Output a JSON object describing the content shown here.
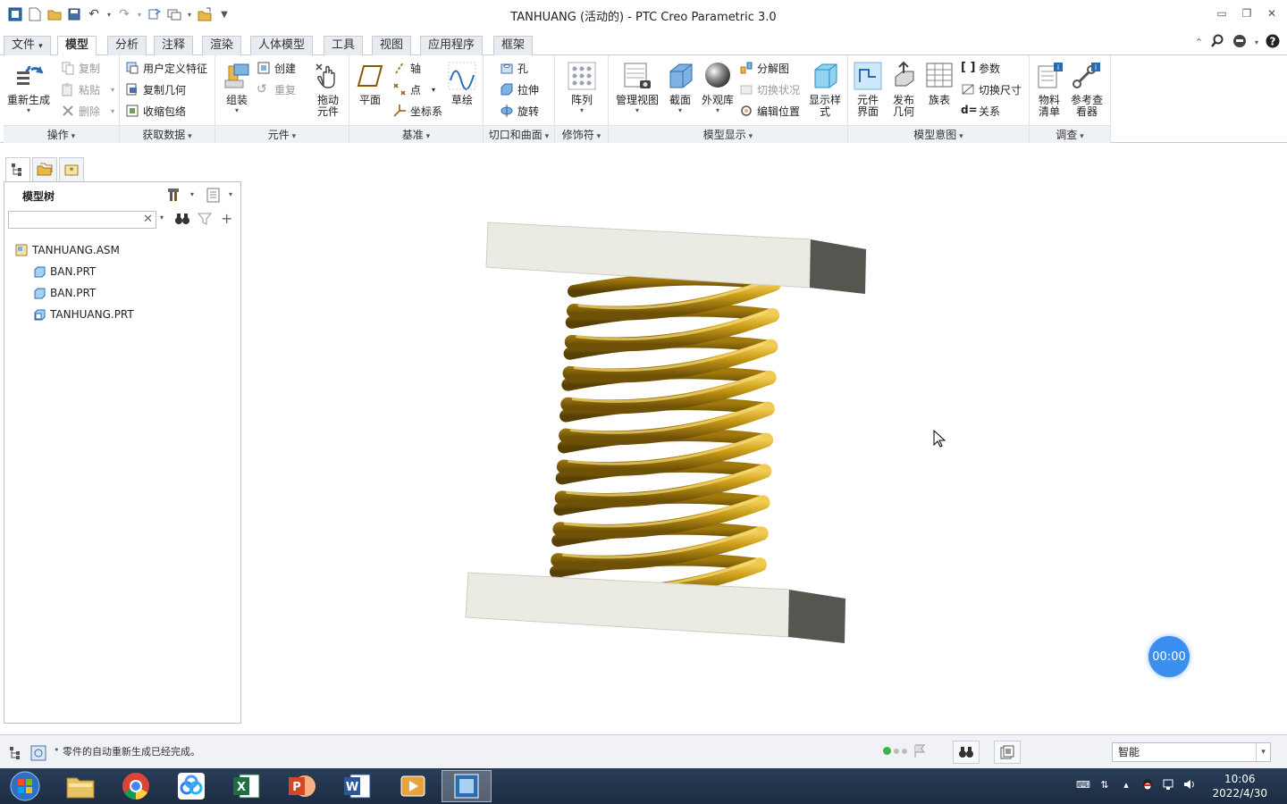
{
  "window": {
    "title": "TANHUANG (活动的) - PTC Creo Parametric 3.0"
  },
  "ribbon": {
    "tabs": [
      "文件",
      "模型",
      "分析",
      "注释",
      "渲染",
      "人体模型",
      "工具",
      "视图",
      "应用程序",
      "框架"
    ],
    "active_tab": "模型",
    "groups": {
      "operations": {
        "label": "操作",
        "regenerate": "重新生成",
        "copy": "复制",
        "paste": "粘贴",
        "delete": "删除"
      },
      "get_data": {
        "label": "获取数据",
        "udf": "用户定义特征",
        "copy_geom": "复制几何",
        "shrinkwrap": "收缩包络"
      },
      "component": {
        "label": "元件",
        "assemble": "组装",
        "create": "创建",
        "repeat": "重复",
        "drag": "拖动元件"
      },
      "datum": {
        "label": "基准",
        "plane": "平面",
        "axis": "轴",
        "point": "点",
        "csys": "坐标系",
        "sketch": "草绘"
      },
      "cut_surface": {
        "label": "切口和曲面",
        "hole": "孔",
        "extrude": "拉伸",
        "revolve": "旋转"
      },
      "modifiers": {
        "label": "修饰符",
        "pattern": "阵列"
      },
      "model_display": {
        "label": "模型显示",
        "manage_views": "管理视图",
        "section": "截面",
        "appearance": "外观库",
        "explode": "分解图",
        "toggle_status": "切换状况",
        "edit_position": "编辑位置",
        "display_style": "显示样式"
      },
      "model_intent": {
        "label": "模型意图",
        "comp_interface": "元件界面",
        "publish_geom": "发布几何",
        "family_table": "族表",
        "params": "参数",
        "switch_dims": "切换尺寸",
        "relations": "关系"
      },
      "investigate": {
        "label": "调查",
        "bom": "物料清单",
        "ref_viewer": "参考查看器"
      }
    }
  },
  "model_tree": {
    "title": "模型树",
    "search_value": "",
    "nodes": [
      {
        "label": "TANHUANG.ASM",
        "type": "assembly"
      },
      {
        "label": "BAN.PRT",
        "type": "part"
      },
      {
        "label": "BAN.PRT",
        "type": "part"
      },
      {
        "label": "TANHUANG.PRT",
        "type": "part"
      }
    ]
  },
  "status": {
    "message": "零件的自动重新生成已经完成。",
    "selection_filter": "智能"
  },
  "timer": {
    "value": "00:00"
  },
  "taskbar": {
    "time": "10:06",
    "date": "2022/4/30"
  },
  "colors": {
    "spring": "#b8900c",
    "plate_face": "#ecebe3",
    "plate_side": "#565550",
    "accent": "#3a8ef0"
  }
}
